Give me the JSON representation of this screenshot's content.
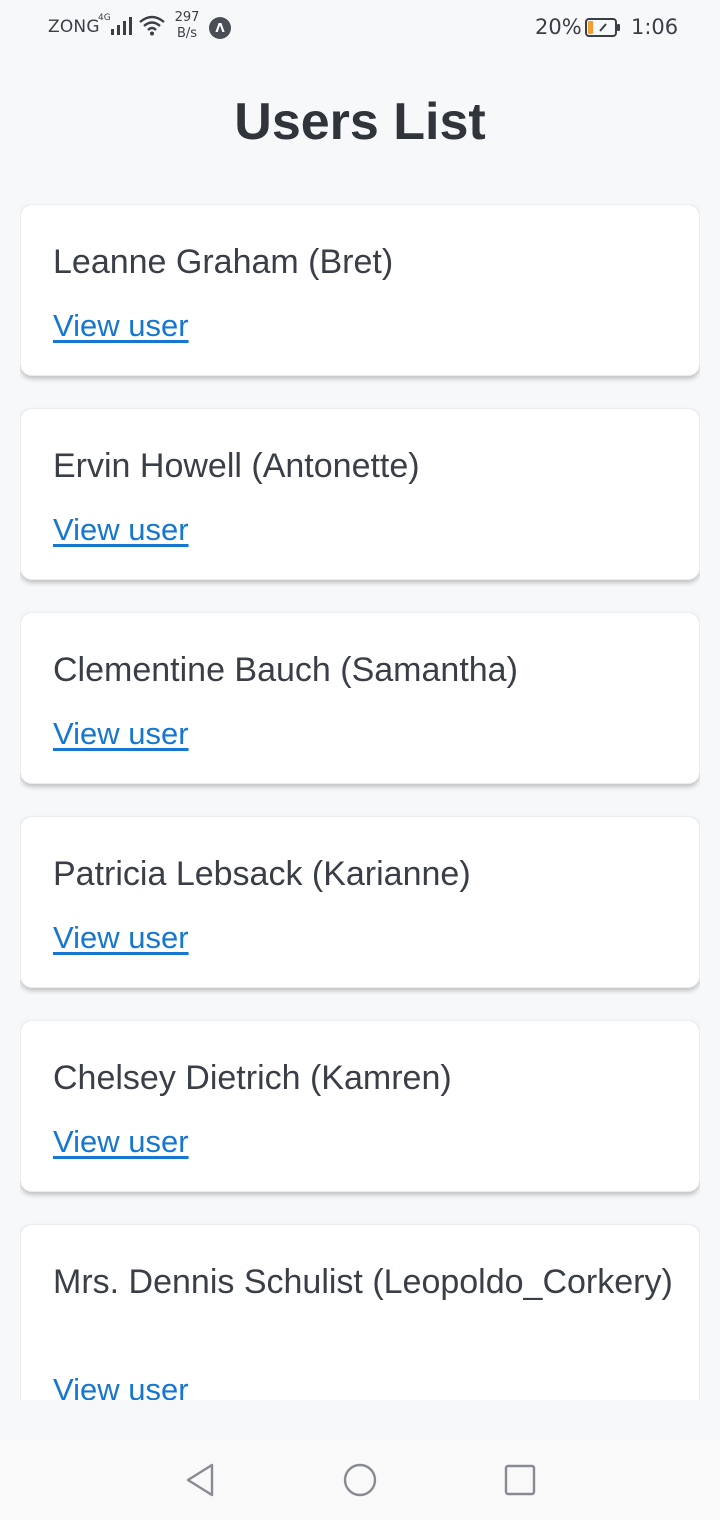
{
  "status_bar": {
    "carrier": "ZONG",
    "network_type": "4G",
    "speed_value": "297",
    "speed_unit": "B/s",
    "app_icon": "a-circle-icon",
    "battery_percent": "20%",
    "battery_level": 0.2,
    "time": "1:06"
  },
  "page": {
    "title": "Users List"
  },
  "users": [
    {
      "display": "Leanne Graham (Bret)",
      "link": "View user"
    },
    {
      "display": "Ervin Howell (Antonette)",
      "link": "View user"
    },
    {
      "display": "Clementine Bauch (Samantha)",
      "link": "View user"
    },
    {
      "display": "Patricia Lebsack (Karianne)",
      "link": "View user"
    },
    {
      "display": "Chelsey Dietrich (Kamren)",
      "link": "View user"
    },
    {
      "display": "Mrs. Dennis Schulist (Leopoldo_Corkery)",
      "link": "View user"
    }
  ],
  "nav": {
    "back_icon": "triangle-back-icon",
    "home_icon": "circle-home-icon",
    "recents_icon": "square-recents-icon"
  },
  "colors": {
    "background": "#f7f8fa",
    "link": "#1677d2",
    "battery_accent": "#f0a030"
  }
}
